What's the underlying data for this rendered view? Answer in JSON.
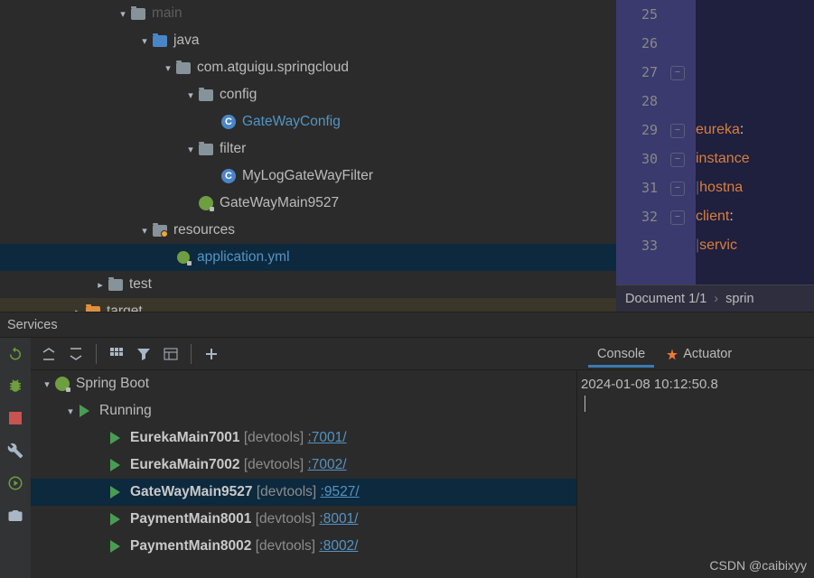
{
  "project": {
    "main": "main",
    "java": "java",
    "pkg": "com.atguigu.springcloud",
    "config_folder": "config",
    "gateway_config": "GateWayConfig",
    "filter_folder": "filter",
    "log_filter": "MyLogGateWayFilter",
    "gateway_main": "GateWayMain9527",
    "resources": "resources",
    "app_yml": "application.yml",
    "test": "test",
    "target": "target"
  },
  "editor": {
    "lines": [
      "25",
      "26",
      "27",
      "28",
      "29",
      "30",
      "31",
      "32",
      "33"
    ],
    "eureka_key": "eureka",
    "instance_key": "instance",
    "hostname_key": "hostna",
    "client_key": "client",
    "service_key": "servic",
    "colon": ":"
  },
  "docbar": {
    "position": "Document 1/1",
    "file": "sprin"
  },
  "services": {
    "title": "Services"
  },
  "run": {
    "spring_boot": "Spring Boot",
    "running": "Running",
    "apps": [
      {
        "name": "EurekaMain7001",
        "devtools": "[devtools]",
        "port": ":7001/"
      },
      {
        "name": "EurekaMain7002",
        "devtools": "[devtools]",
        "port": ":7002/"
      },
      {
        "name": "GateWayMain9527",
        "devtools": "[devtools]",
        "port": ":9527/"
      },
      {
        "name": "PaymentMain8001",
        "devtools": "[devtools]",
        "port": ":8001/"
      },
      {
        "name": "PaymentMain8002",
        "devtools": "[devtools]",
        "port": ":8002/"
      }
    ]
  },
  "console": {
    "tab_console": "Console",
    "tab_actuator": "Actuator",
    "output": "2024-01-08 10:12:50.8"
  },
  "watermark": "CSDN @caibixyy"
}
